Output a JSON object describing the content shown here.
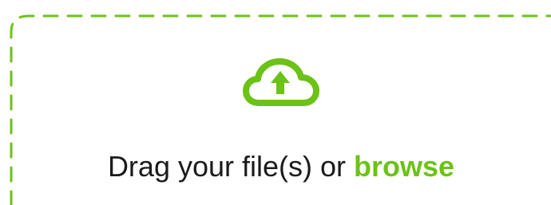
{
  "dropzone": {
    "prompt_text": "Drag your file(s) or ",
    "browse_label": "browse",
    "upload_icon": "cloud-upload-icon",
    "accent_color": "#6cc217",
    "text_color": "#1b1b1b"
  }
}
